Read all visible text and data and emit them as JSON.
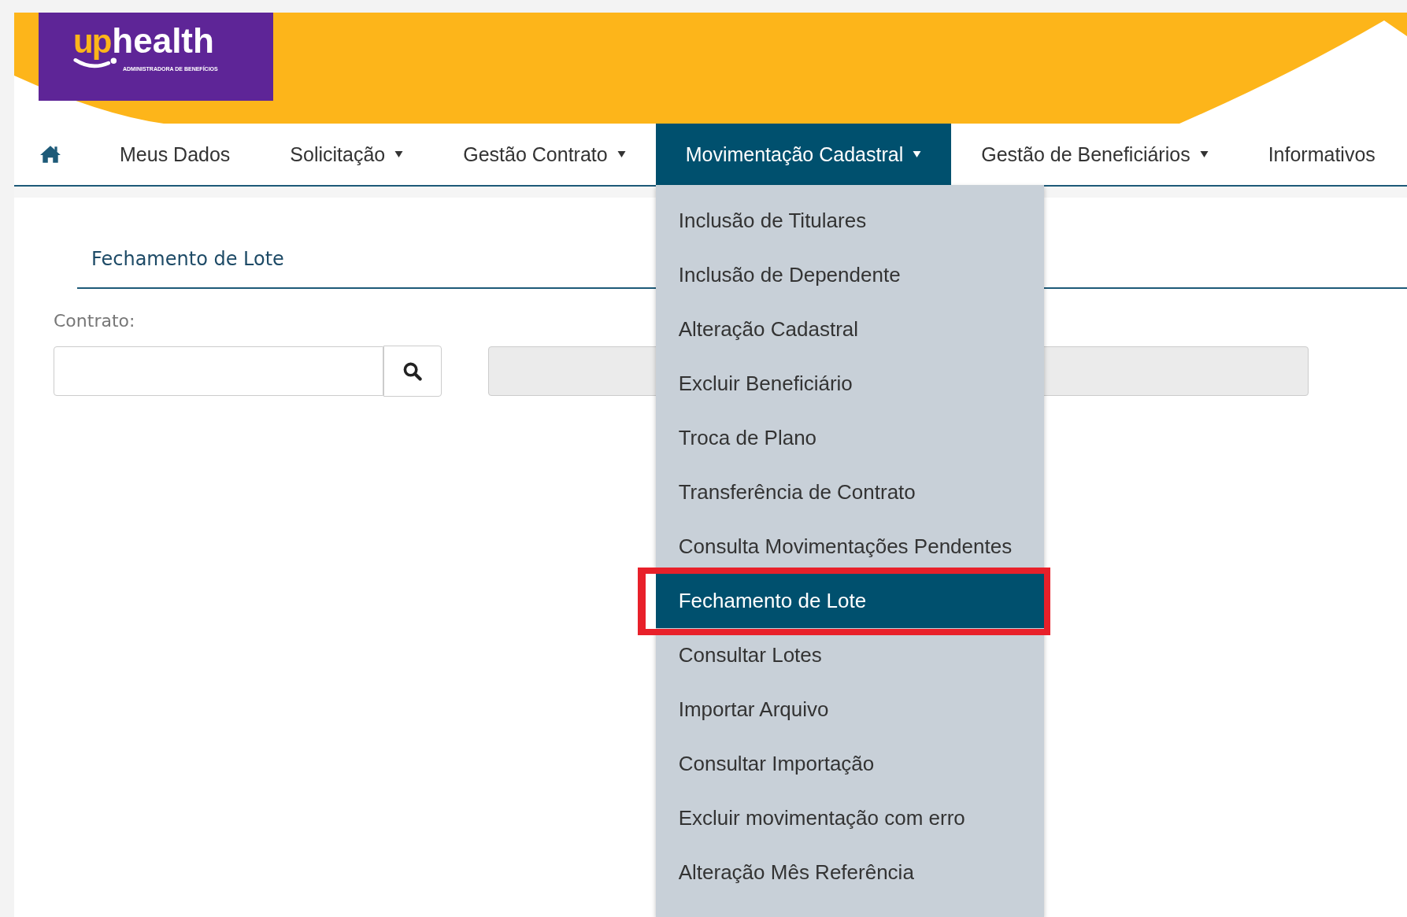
{
  "logo": {
    "prefix": "up",
    "name": "health",
    "tagline": "ADMINISTRADORA DE BENEFÍCIOS"
  },
  "nav": [
    {
      "kind": "home",
      "selected": false
    },
    {
      "kind": "link",
      "label": "Meus Dados",
      "selected": false
    },
    {
      "kind": "dropdown",
      "label": "Solicitação",
      "selected": false
    },
    {
      "kind": "dropdown",
      "label": "Gestão Contrato",
      "selected": false
    },
    {
      "kind": "dropdown",
      "label": "Movimentação Cadastral",
      "selected": true
    },
    {
      "kind": "dropdown",
      "label": "Gestão de Beneficiários",
      "selected": false
    },
    {
      "kind": "link",
      "label": "Informativos",
      "selected": false
    }
  ],
  "dropdown": [
    {
      "label": "Inclusão de Titulares",
      "selected": false,
      "annotated": false
    },
    {
      "label": "Inclusão de Dependente",
      "selected": false,
      "annotated": false
    },
    {
      "label": "Alteração Cadastral",
      "selected": false,
      "annotated": false
    },
    {
      "label": "Excluir Beneficiário",
      "selected": false,
      "annotated": false
    },
    {
      "label": "Troca de Plano",
      "selected": false,
      "annotated": false
    },
    {
      "label": "Transferência de Contrato",
      "selected": false,
      "annotated": false
    },
    {
      "label": "Consulta Movimentações Pendentes",
      "selected": false,
      "annotated": false
    },
    {
      "label": "Fechamento de Lote",
      "selected": true,
      "annotated": true
    },
    {
      "label": "Consultar Lotes",
      "selected": false,
      "annotated": false
    },
    {
      "label": "Importar Arquivo",
      "selected": false,
      "annotated": false
    },
    {
      "label": "Consultar Importação",
      "selected": false,
      "annotated": false
    },
    {
      "label": "Excluir movimentação com erro",
      "selected": false,
      "annotated": false
    },
    {
      "label": "Alteração Mês Referência",
      "selected": false,
      "annotated": false
    }
  ],
  "page_title": "Fechamento de Lote",
  "contract": {
    "label": "Contrato:",
    "disabled_field": true
  }
}
